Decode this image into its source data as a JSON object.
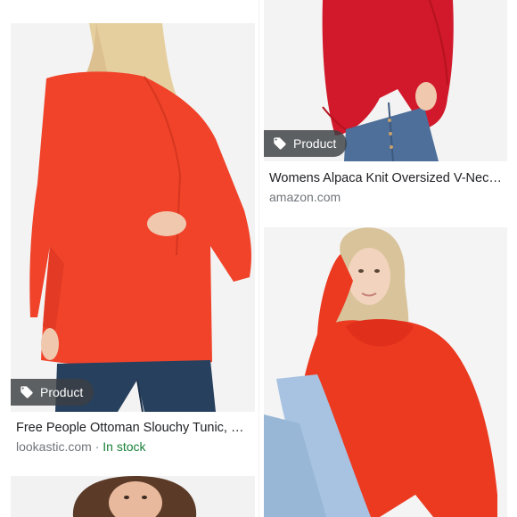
{
  "cards": [
    {
      "badge": "Product",
      "title": "Free People Ottoman Slouchy Tunic, $…",
      "source": "lookastic.com",
      "separator": "·",
      "availability": "In stock",
      "image_subject": "model in red oversized off-shoulder knit tunic and jeans"
    },
    {
      "badge": "Product",
      "title": "Womens Alpaca Knit Oversized V-Neck…",
      "source": "amazon.com",
      "image_subject": "red knit sweater with jeans"
    },
    {
      "image_subject": "model in red fuzzy cowl-neck sweater and jeans"
    },
    {
      "image_subject": "partial view of a model with dark hair"
    }
  ],
  "colors": {
    "title": "#202124",
    "source": "#70757a",
    "in_stock": "#188038",
    "badge_bg": "#3c4043"
  }
}
